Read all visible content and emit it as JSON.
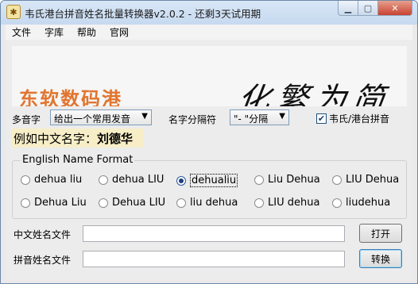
{
  "window": {
    "title": "韦氏港台拼音姓名批量转换器v2.0.2 - 还剩3天试用期",
    "icon": "app-logo-icon"
  },
  "menu": [
    "文件",
    "字库",
    "帮助",
    "官网"
  ],
  "banner": {
    "left_text": "东软数码港",
    "right_text": "化繁为简"
  },
  "options": {
    "polyphone_label": "多音字",
    "polyphone_value": "给出一个常用发音",
    "separator_label": "名字分隔符",
    "separator_value": "\"- \"分隔",
    "wade_label": "韦氏/港台拼音",
    "wade_checked": true
  },
  "example": {
    "prefix": "例如中文名字：",
    "name": "刘德华"
  },
  "format_group": {
    "title": "English Name Format",
    "options": [
      {
        "label": "dehua liu",
        "selected": false
      },
      {
        "label": "dehua LIU",
        "selected": false
      },
      {
        "label": "dehualiu",
        "selected": true
      },
      {
        "label": "Liu Dehua",
        "selected": false
      },
      {
        "label": "LIU Dehua",
        "selected": false
      },
      {
        "label": "Dehua Liu",
        "selected": false
      },
      {
        "label": "Dehua LIU",
        "selected": false
      },
      {
        "label": "liu dehua",
        "selected": false
      },
      {
        "label": "LIU dehua",
        "selected": false
      },
      {
        "label": "liudehua",
        "selected": false
      }
    ]
  },
  "files": {
    "chinese_label": "中文姓名文件",
    "chinese_value": "",
    "open_button": "打开",
    "pinyin_label": "拼音姓名文件",
    "pinyin_value": "",
    "convert_button": "转换"
  },
  "colors": {
    "banner_accent": "#e2752f",
    "example_bg": "#f7eec8",
    "close_button": "#c8432f"
  }
}
